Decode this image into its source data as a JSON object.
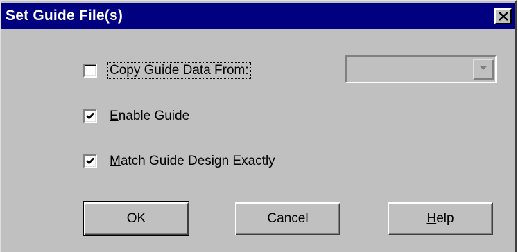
{
  "dialog": {
    "title": "Set Guide File(s)",
    "close_icon": "close-icon"
  },
  "options": {
    "copy_guide": {
      "label_mnemonic": "C",
      "label_rest": "opy Guide Data From:",
      "checked": false
    },
    "enable_guide": {
      "label_mnemonic": "E",
      "label_rest": "nable Guide",
      "checked": true
    },
    "match_design": {
      "label_mnemonic": "M",
      "label_rest": "atch Guide Design Exactly",
      "checked": true
    }
  },
  "source_combo": {
    "value": "",
    "enabled": false
  },
  "buttons": {
    "ok": "OK",
    "cancel": "Cancel",
    "help_mnemonic": "H",
    "help_rest": "elp"
  },
  "colors": {
    "title_bar": "#000080",
    "face": "#c0c0c0"
  }
}
